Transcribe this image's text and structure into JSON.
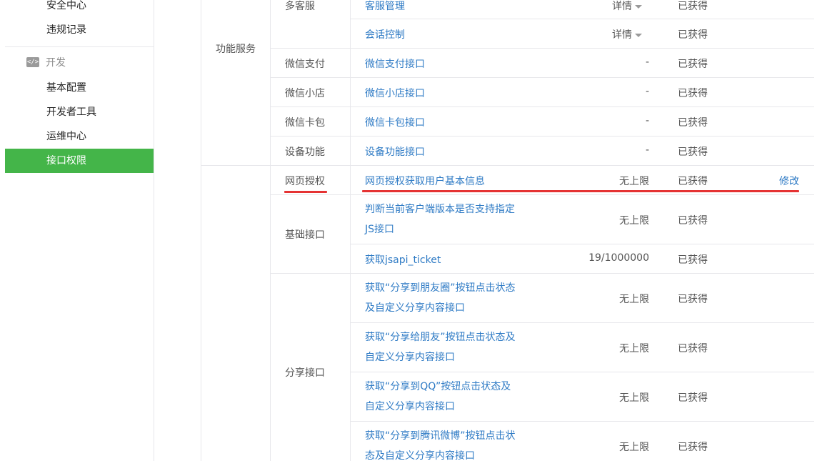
{
  "sidebar": {
    "items_top": [
      "安全中心",
      "违规记录"
    ],
    "group_label": "开发",
    "group_icon": "code-icon",
    "dev_items": [
      "基本配置",
      "开发者工具",
      "运维中心",
      "接口权限"
    ],
    "active_item": "接口权限",
    "accent_color": "#44b549"
  },
  "table": {
    "category_service": "功能服务",
    "rows": [
      {
        "sub": "多客服",
        "api": "客服管理",
        "quota": "详情",
        "status": "已获得"
      },
      {
        "sub": "",
        "api": "会话控制",
        "quota": "详情",
        "status": "已获得"
      },
      {
        "sub": "微信支付",
        "api": "微信支付接口",
        "quota": "-",
        "status": "已获得"
      },
      {
        "sub": "微信小店",
        "api": "微信小店接口",
        "quota": "-",
        "status": "已获得"
      },
      {
        "sub": "微信卡包",
        "api": "微信卡包接口",
        "quota": "-",
        "status": "已获得"
      },
      {
        "sub": "设备功能",
        "api": "设备功能接口",
        "quota": "-",
        "status": "已获得"
      },
      {
        "sub": "网页授权",
        "api": "网页授权获取用户基本信息",
        "quota": "无上限",
        "status": "已获得",
        "action": "修改"
      },
      {
        "sub": "基础接口",
        "api": "判断当前客户端版本是否支持指定JS接口",
        "quota": "无上限",
        "status": "已获得"
      },
      {
        "sub": "",
        "api": "获取jsapi_ticket",
        "quota": "19/1000000",
        "status": "已获得"
      },
      {
        "sub": "分享接口",
        "api": "获取“分享到朋友圈”按钮点击状态及自定义分享内容接口",
        "quota": "无上限",
        "status": "已获得"
      },
      {
        "sub": "",
        "api": "获取“分享给朋友”按钮点击状态及自定义分享内容接口",
        "quota": "无上限",
        "status": "已获得"
      },
      {
        "sub": "",
        "api": "获取“分享到QQ”按钮点击状态及自定义分享内容接口",
        "quota": "无上限",
        "status": "已获得"
      },
      {
        "sub": "",
        "api": "获取“分享到腾讯微博”按钮点击状态及自定义分享内容接口",
        "quota": "无上限",
        "status": "已获得"
      }
    ],
    "link_color": "#2f7bc5",
    "highlight_color": "#e53333"
  }
}
